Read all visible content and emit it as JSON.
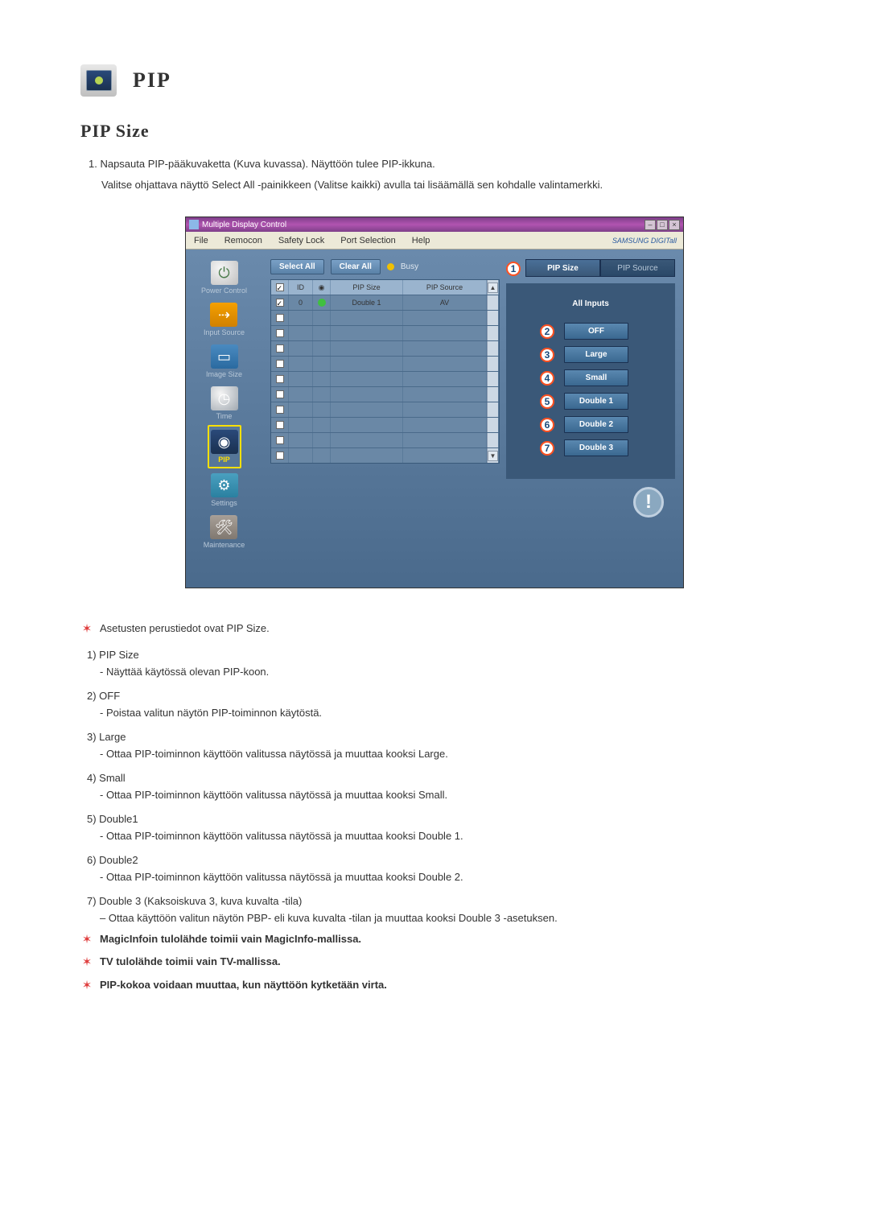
{
  "header": {
    "title": "PIP",
    "subtitle": "PIP Size"
  },
  "instructions": {
    "line1": "1. Napsauta PIP-pääkuvaketta (Kuva kuvassa). Näyttöön tulee PIP-ikkuna.",
    "line2": "Valitse ohjattava näyttö Select All -painikkeen (Valitse kaikki) avulla tai lisäämällä sen kohdalle valintamerkki."
  },
  "app": {
    "window_title": "Multiple Display Control",
    "menu": {
      "file": "File",
      "remocon": "Remocon",
      "safety_lock": "Safety Lock",
      "port_selection": "Port Selection",
      "help": "Help",
      "brand": "SAMSUNG DIGITall"
    },
    "sidebar": {
      "power": "Power Control",
      "input": "Input Source",
      "image": "Image Size",
      "time": "Time",
      "pip": "PIP",
      "settings": "Settings",
      "maintenance": "Maintenance"
    },
    "actions": {
      "select_all": "Select All",
      "clear_all": "Clear All",
      "busy": "Busy"
    },
    "grid": {
      "col_id": "ID",
      "col_pipsize": "PIP Size",
      "col_pipsource": "PIP Source",
      "row0_id": "0",
      "row0_pipsize": "Double 1",
      "row0_pipsource": "AV"
    },
    "tabs": {
      "pip_size": "PIP Size",
      "pip_source": "PIP Source"
    },
    "controls": {
      "all_inputs": "All Inputs",
      "off": "OFF",
      "large": "Large",
      "small": "Small",
      "double1": "Double 1",
      "double2": "Double 2",
      "double3": "Double 3"
    },
    "markers": {
      "m1": "1",
      "m2": "2",
      "m3": "3",
      "m4": "4",
      "m5": "5",
      "m6": "6",
      "m7": "7"
    }
  },
  "bullets": {
    "star1": "Asetusten perustiedot ovat PIP Size.",
    "n1_title": "1) PIP Size",
    "n1_desc": "- Näyttää käytössä olevan PIP-koon.",
    "n2_title": "2) OFF",
    "n2_desc": "- Poistaa valitun näytön PIP-toiminnon käytöstä.",
    "n3_title": "3) Large",
    "n3_desc": "- Ottaa PIP-toiminnon käyttöön valitussa näytössä ja muuttaa kooksi Large.",
    "n4_title": "4) Small",
    "n4_desc": "- Ottaa PIP-toiminnon käyttöön valitussa näytössä ja muuttaa kooksi Small.",
    "n5_title": "5) Double1",
    "n5_desc": "- Ottaa PIP-toiminnon käyttöön valitussa näytössä ja muuttaa kooksi Double 1.",
    "n6_title": "6) Double2",
    "n6_desc": "- Ottaa PIP-toiminnon käyttöön valitussa näytössä ja muuttaa kooksi Double 2.",
    "n7_title": "7) Double 3 (Kaksoiskuva 3, kuva kuvalta -tila)",
    "n7_desc": "– Ottaa käyttöön valitun näytön PBP- eli kuva kuvalta -tilan ja muuttaa kooksi Double 3 -asetuksen.",
    "star2": "MagicInfoin tulolähde toimii vain MagicInfo-mallissa.",
    "star3": "TV tulolähde toimii vain TV-mallissa.",
    "star4": "PIP-kokoa voidaan muuttaa, kun näyttöön kytketään virta."
  }
}
